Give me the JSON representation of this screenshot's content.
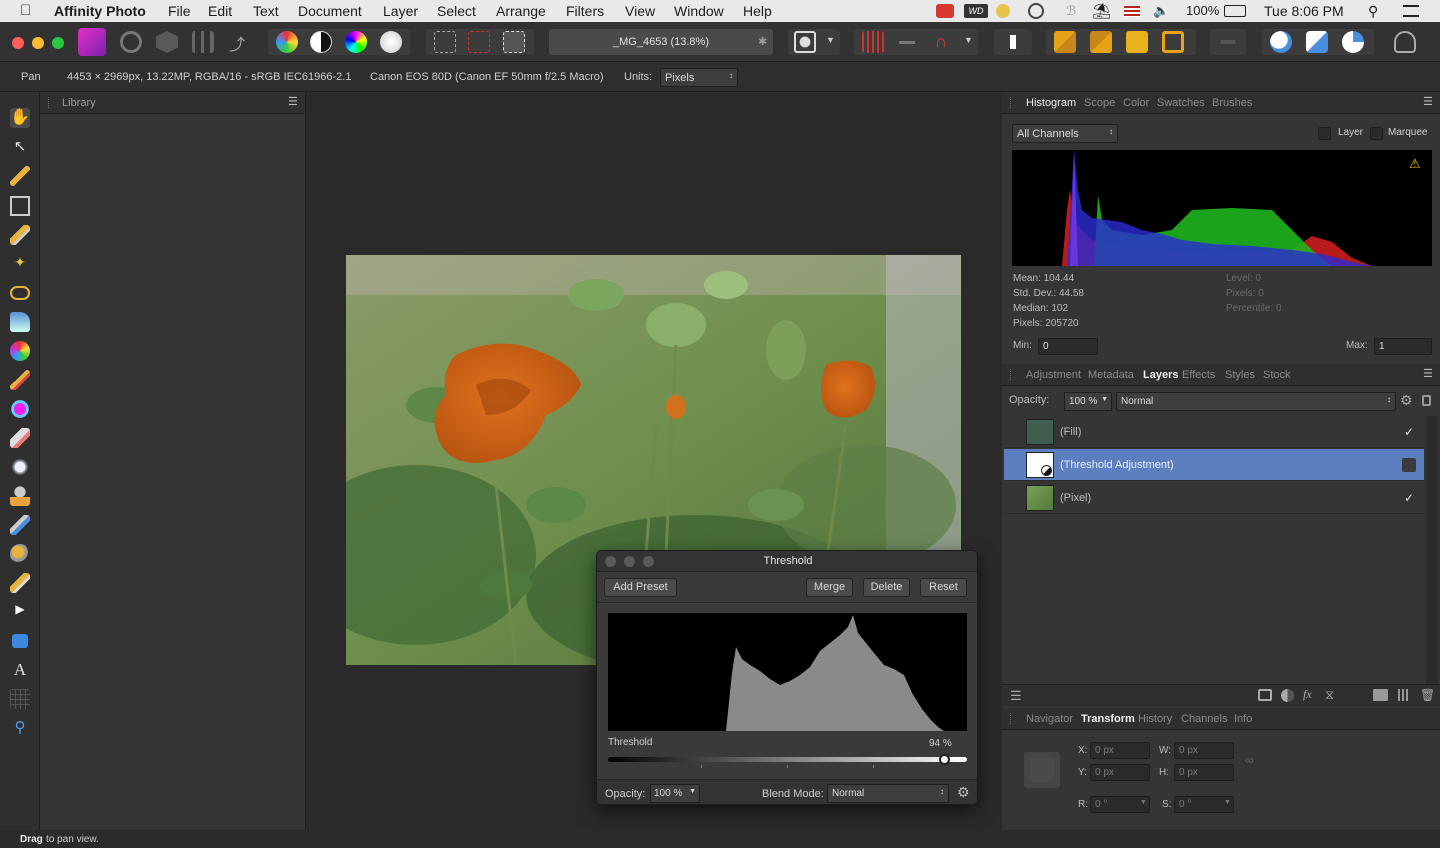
{
  "menubar": {
    "app_name": "Affinity Photo",
    "menus": [
      "File",
      "Edit",
      "Text",
      "Document",
      "Layer",
      "Select",
      "Arrange",
      "Filters",
      "View",
      "Window",
      "Help"
    ],
    "battery": "100%",
    "clock": "Tue 8:06 PM"
  },
  "toolbar": {
    "document_title": "_MG_4653 (13.8%)"
  },
  "context": {
    "tool_name": "Pan",
    "image_info": "4453 × 2969px, 13.22MP, RGBA/16 - sRGB IEC61966-2.1",
    "camera_info": "Canon EOS 80D (Canon EF 50mm f/2.5 Macro)",
    "units_label": "Units:",
    "units_value": "Pixels"
  },
  "library": {
    "title": "Library"
  },
  "histogram_panel": {
    "tabs": [
      "Histogram",
      "Scope",
      "Color",
      "Swatches",
      "Brushes"
    ],
    "active_tab": "Histogram",
    "channel_select": "All Channels",
    "layer_label": "Layer",
    "marquee_label": "Marquee",
    "stats": {
      "mean": "Mean: 104.44",
      "std_dev": "Std. Dev.: 44.58",
      "median": "Median: 102",
      "pixels": "Pixels: 205720",
      "level": "Level: 0",
      "pixels_right": "Pixels: 0",
      "percentile": "Percentile: 0"
    },
    "min_label": "Min:",
    "min_value": "0",
    "max_label": "Max:",
    "max_value": "1"
  },
  "layers_panel": {
    "tabs": [
      "Adjustment",
      "Metadata",
      "Layers",
      "Effects",
      "Styles",
      "Stock"
    ],
    "active_tab": "Layers",
    "opacity_label": "Opacity:",
    "opacity_value": "100 %",
    "blend_mode": "Normal",
    "layers": [
      {
        "name": "(Fill)",
        "visible": true,
        "selected": false
      },
      {
        "name": "(Threshold Adjustment)",
        "visible": false,
        "selected": true
      },
      {
        "name": "(Pixel)",
        "visible": true,
        "selected": false
      }
    ]
  },
  "transform_panel": {
    "tabs": [
      "Navigator",
      "Transform",
      "History",
      "Channels",
      "Info"
    ],
    "active_tab": "Transform",
    "x_label": "X:",
    "x_value": "0 px",
    "y_label": "Y:",
    "y_value": "0 px",
    "w_label": "W:",
    "w_value": "0 px",
    "h_label": "H:",
    "h_value": "0 px",
    "r_label": "R:",
    "r_value": "0 °",
    "s_label": "S:",
    "s_value": "0 °"
  },
  "threshold_dialog": {
    "title": "Threshold",
    "add_preset": "Add Preset",
    "merge": "Merge",
    "delete": "Delete",
    "reset": "Reset",
    "threshold_label": "Threshold",
    "threshold_value": "94 %",
    "threshold_fraction": 0.94,
    "opacity_label": "Opacity:",
    "opacity_value": "100 %",
    "blend_label": "Blend Mode:",
    "blend_value": "Normal"
  },
  "status": {
    "bold": "Drag",
    "rest": " to pan view."
  },
  "colors": {
    "accent_selection": "#5b7fbf",
    "app_icon": "#c51ea7",
    "window_close": "#ff5f57",
    "window_min": "#febc2e",
    "window_max": "#28c840"
  }
}
